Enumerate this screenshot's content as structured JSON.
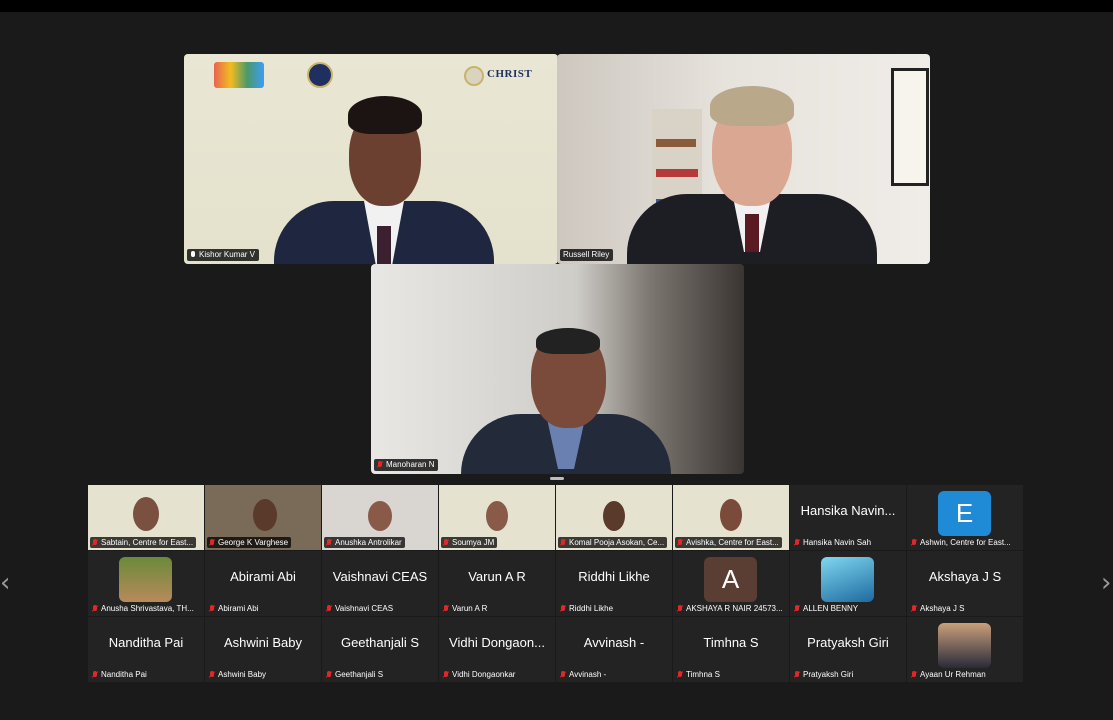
{
  "speakers": [
    {
      "name": "Kishor Kumar V",
      "active": true,
      "mic": "on"
    },
    {
      "name": "Russell Riley",
      "active": false,
      "mic": "none"
    },
    {
      "name": "Manoharan N",
      "active": false,
      "mic": "off"
    }
  ],
  "kishor_logos": {
    "christ": "CHRIST"
  },
  "gallery": {
    "rows": [
      [
        {
          "name": "Sabtain, Centre for East...",
          "type": "video"
        },
        {
          "name": "George K Varghese",
          "type": "video"
        },
        {
          "name": "Anushka Antrolikar",
          "type": "video"
        },
        {
          "name": "Soumya JM",
          "type": "video"
        },
        {
          "name": "Komal Pooja Asokan, Ce...",
          "type": "video"
        },
        {
          "name": "Avishka, Centre for East...",
          "type": "video"
        },
        {
          "name": "Hansika Navin Sah",
          "display": "Hansika Navin...",
          "type": "name"
        },
        {
          "name": "Ashwin, Centre for East...",
          "type": "letter",
          "letter": "E",
          "color": "#1f8ad6"
        }
      ],
      [
        {
          "name": "Anusha Shrivastava, TH...",
          "type": "photo"
        },
        {
          "name": "Abirami Abi",
          "display": "Abirami Abi",
          "type": "name"
        },
        {
          "name": "Vaishnavi CEAS",
          "display": "Vaishnavi CEAS",
          "type": "name"
        },
        {
          "name": "Varun A R",
          "display": "Varun A R",
          "type": "name"
        },
        {
          "name": "Riddhi Likhe",
          "display": "Riddhi Likhe",
          "type": "name"
        },
        {
          "name": "AKSHAYA R NAIR 24573...",
          "type": "letter",
          "letter": "A",
          "color": "#5a3d33"
        },
        {
          "name": "ALLEN BENNY",
          "type": "photo2"
        },
        {
          "name": "Akshaya J S",
          "display": "Akshaya J S",
          "type": "name"
        }
      ],
      [
        {
          "name": "Nanditha Pai",
          "display": "Nanditha Pai",
          "type": "name"
        },
        {
          "name": "Ashwini Baby",
          "display": "Ashwini Baby",
          "type": "name"
        },
        {
          "name": "Geethanjali S",
          "display": "Geethanjali S",
          "type": "name"
        },
        {
          "name": "Vidhi Dongaonkar",
          "display": "Vidhi Dongaon...",
          "type": "name"
        },
        {
          "name": "Avvinash -",
          "display": "Avvinash -",
          "type": "name"
        },
        {
          "name": "Timhna S",
          "display": "Timhna S",
          "type": "name"
        },
        {
          "name": "Pratyaksh Giri",
          "display": "Pratyaksh Giri",
          "type": "name"
        },
        {
          "name": "Ayaan Ur Rehman",
          "type": "photo3"
        }
      ]
    ]
  },
  "nav": {
    "prev": "‹",
    "next": "›"
  }
}
